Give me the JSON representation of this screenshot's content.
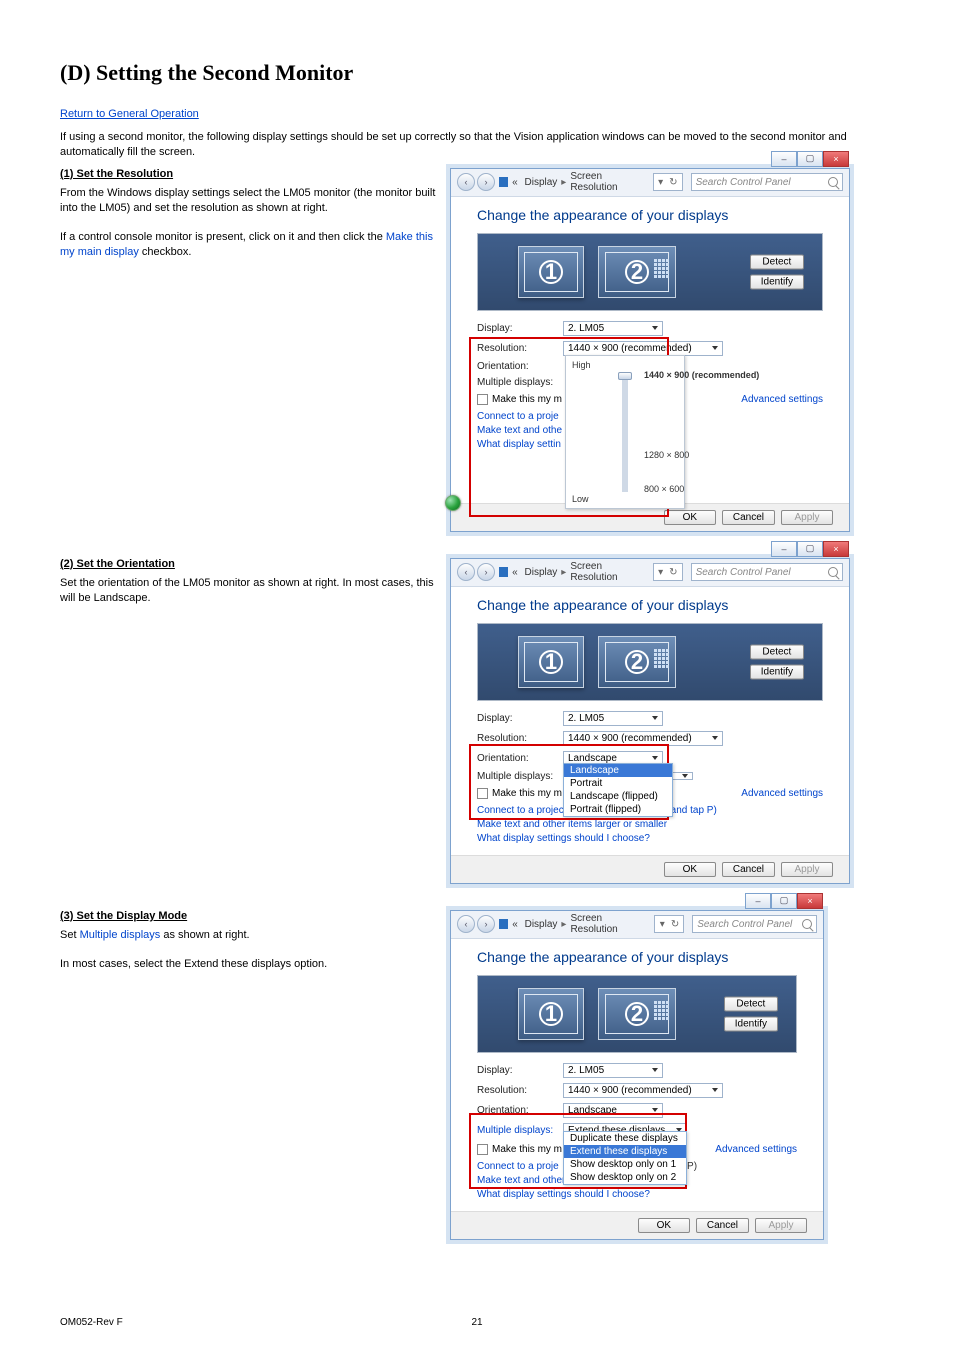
{
  "page": {
    "title": "(D) Setting the Second Monitor",
    "return_link": "Return to General Operation",
    "intro": "If using a second monitor, the following display settings should be set up correctly so that the Vision application windows can be moved to the second monitor and automatically fill the screen.",
    "footer_page": "21",
    "footer_rev": "OM052-Rev F"
  },
  "item1": {
    "heading": "(1) Set the Resolution",
    "line1": "From the Windows display settings select the LM05 monitor (the monitor built into the LM05) and set the resolution as shown at right.",
    "line2_prefix": "If a control console monitor is present, click on it and then click the ",
    "link": "Make this my main display",
    "line2_suffix": " checkbox."
  },
  "item2": {
    "heading": "(2) Set the Orientation",
    "text": "Set the orientation of the LM05 monitor as shown at right. In most cases, this will be Landscape."
  },
  "item3": {
    "heading": "(3) Set the Display Mode",
    "line1_prefix": "Set ",
    "link": "Multiple displays",
    "line1_suffix": " as shown at right.",
    "line2": "In most cases, select the Extend these displays option."
  },
  "win": {
    "breadcrumb_display": "Display",
    "breadcrumb_sr": "Screen Resolution",
    "search_placeholder": "Search Control Panel",
    "heading": "Change the appearance of your displays",
    "detect": "Detect",
    "identify": "Identify",
    "display_label": "Display:",
    "resolution_label": "Resolution:",
    "orientation_label": "Orientation:",
    "multiple_label": "Multiple displays:",
    "make_main": "Make this my main display",
    "make_main_trunc1": "Make this my m",
    "make_main_trunc3": "Make this my m",
    "advanced": "Advanced settings",
    "projector_full": "Connect to a projector (or press the 🪟 key and tap P)",
    "projector_trunc": "Connect to a proje",
    "projector_trunc3": "Connect to a proje",
    "larger_full": "Make text and other items larger or smaller",
    "larger_trunc": "Make text and othe",
    "choose_full": "What display settings should I choose?",
    "choose_trunc": "What display settin",
    "ok": "OK",
    "cancel": "Cancel",
    "apply": "Apply",
    "display_value": "2. LM05",
    "resolution_value": "1440 × 900 (recommended)",
    "orientation_value": "Landscape",
    "multiple_value": "Extend these displays",
    "tap_p": "p P)"
  },
  "slider": {
    "high": "High",
    "top_label": "1440 × 900 (recommended)",
    "mid_label": "1280 × 800",
    "bottom_label": "800 × 600",
    "low": "Low"
  },
  "orient_opts": {
    "o1": "Landscape",
    "o2": "Portrait",
    "o3": "Landscape (flipped)",
    "o4": "Portrait (flipped)"
  },
  "multi_opts": {
    "m1": "Duplicate these displays",
    "m2": "Extend these displays",
    "m3": "Show desktop only on 1",
    "m4": "Show desktop only on 2"
  }
}
